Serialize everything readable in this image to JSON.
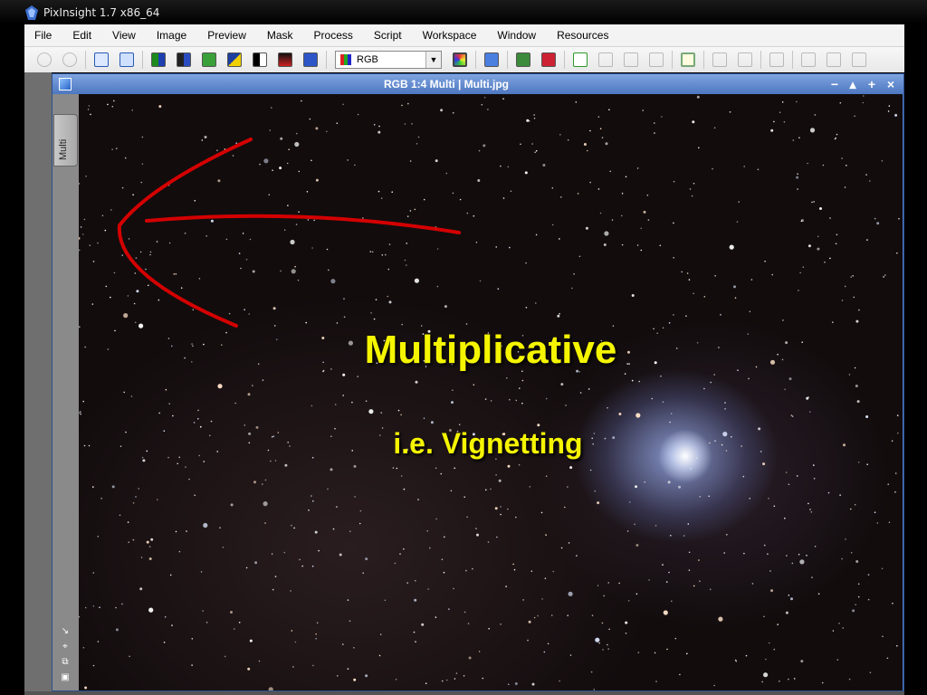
{
  "app": {
    "title": "PixInsight 1.7 x86_64"
  },
  "menu": [
    "File",
    "Edit",
    "View",
    "Image",
    "Preview",
    "Mask",
    "Process",
    "Script",
    "Workspace",
    "Window",
    "Resources"
  ],
  "toolbar": {
    "color_space_value": "RGB"
  },
  "image_window": {
    "title": "RGB 1:4 Multi | Multi.jpg",
    "view_tab_label": "Multi",
    "controls": [
      "−",
      "▴",
      "+",
      "×"
    ]
  },
  "overlay": {
    "headline": "Multiplicative",
    "subtitle": "i.e. Vignetting",
    "text_color": "#f5f500",
    "arrow_color": "#d40000"
  }
}
